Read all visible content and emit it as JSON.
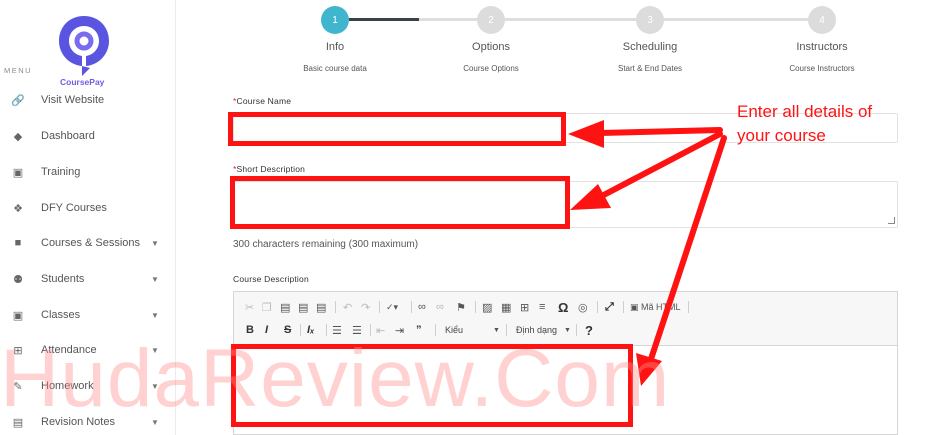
{
  "sidebar": {
    "brand": "CoursePay",
    "menu_label": "MENU",
    "items": [
      {
        "label": "Visit Website",
        "icon": "link-icon"
      },
      {
        "label": "Dashboard",
        "icon": "fire-icon"
      },
      {
        "label": "Training",
        "icon": "video-icon"
      },
      {
        "label": "DFY Courses",
        "icon": "gift-icon"
      },
      {
        "label": "Courses & Sessions",
        "icon": "book-icon"
      },
      {
        "label": "Students",
        "icon": "users-icon"
      },
      {
        "label": "Classes",
        "icon": "chalkboard-icon"
      },
      {
        "label": "Attendance",
        "icon": "grid-icon"
      },
      {
        "label": "Homework",
        "icon": "edit-icon"
      },
      {
        "label": "Revision Notes",
        "icon": "note-icon"
      }
    ]
  },
  "stepper": {
    "steps": [
      {
        "number": "1",
        "title": "Info",
        "subtitle": "Basic course data"
      },
      {
        "number": "2",
        "title": "Options",
        "subtitle": "Course Options"
      },
      {
        "number": "3",
        "title": "Scheduling",
        "subtitle": "Start & End Dates"
      },
      {
        "number": "4",
        "title": "Instructors",
        "subtitle": "Course Instructors"
      }
    ],
    "active_step": 1
  },
  "form": {
    "required_mark": "*",
    "course_name_label": "Course Name",
    "course_name_value": "",
    "short_description_label": "Short Description",
    "short_description_value": "",
    "char_counter": "300 characters remaining (300 maximum)",
    "course_description_label": "Course Description"
  },
  "editor": {
    "source_label": "Mã HTML",
    "styles_combo": "Kiểu",
    "format_combo": "Định dạng",
    "help": "?"
  },
  "annotation": {
    "line1": "Enter all details of",
    "line2": "your course"
  },
  "watermark": "HudaReview.Com",
  "colors": {
    "accent": "#3fb6cd",
    "brand": "#6f5ce6",
    "annotation": "#ff1212",
    "required": "#e21c1c"
  }
}
